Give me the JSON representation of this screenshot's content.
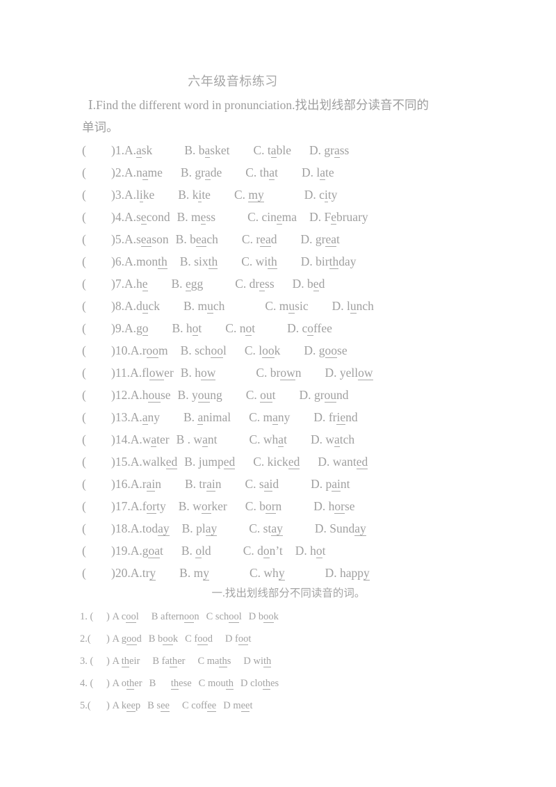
{
  "document": {
    "title": "六年级音标练习",
    "section1": {
      "instruction_prefix": "Ⅰ.Find the different word in pronunciation.",
      "instruction_cn": "找出划线部分读音不同的",
      "instruction_cn2": "单词。",
      "paren_open": "(",
      "paren_close": ")",
      "questions": [
        {
          "num": "1.",
          "a": "A.",
          "a_pre": "",
          "a_u": "a",
          "a_post": "sk",
          "b": "B.",
          "b_pre": "b",
          "b_u": "a",
          "b_post": "sket",
          "c": "C.",
          "c_pre": "t",
          "c_u": "a",
          "c_post": "ble",
          "d": "D.",
          "d_pre": "gr",
          "d_u": "a",
          "d_post": "ss",
          "gap1": "sp5",
          "gap2": "sp4",
          "gap3": "sp3"
        },
        {
          "num": "2.",
          "a": "A.",
          "a_pre": "n",
          "a_u": "a",
          "a_post": "me",
          "b": "B.",
          "b_pre": "gr",
          "b_u": "a",
          "b_post": "de",
          "c": "C.",
          "c_pre": "th",
          "c_u": "a",
          "c_post": "t",
          "d": "D.",
          "d_pre": "l",
          "d_u": "a",
          "d_post": "te",
          "gap1": "sp3",
          "gap2": "sp4",
          "gap3": "sp4"
        },
        {
          "num": "3.",
          "a": "A.",
          "a_pre": "l",
          "a_u": "i",
          "a_post": "ke",
          "b": "B.",
          "b_pre": "k",
          "b_u": "i",
          "b_post": "te",
          "c": "C.",
          "c_pre": "",
          "c_u": "my",
          "c_post": "",
          "d": "D.",
          "d_pre": "c",
          "d_u": "i",
          "d_post": "ty",
          "gap1": "sp4",
          "gap2": "sp4",
          "gap3": "sp6"
        },
        {
          "num": "4.",
          "a": "A.",
          "a_pre": "s",
          "a_u": "e",
          "a_post": "cond",
          "b": "B.",
          "b_pre": "m",
          "b_u": "e",
          "b_post": "ss",
          "c": "C.",
          "c_pre": "cin",
          "c_u": "e",
          "c_post": "ma",
          "d": "D.",
          "d_pre": "F",
          "d_u": "e",
          "d_post": "bruary",
          "gap1": "sp1",
          "gap2": "sp5",
          "gap3": "sp2"
        },
        {
          "num": "5.",
          "a": "A.",
          "a_pre": "s",
          "a_u": "ea",
          "a_post": "son",
          "b": "B.",
          "b_pre": "b",
          "b_u": "ea",
          "b_post": "ch",
          "c": "C.",
          "c_pre": "r",
          "c_u": "ea",
          "c_post": "d",
          "d": "D.",
          "d_pre": "gr",
          "d_u": "ea",
          "d_post": "t",
          "gap1": "sp1",
          "gap2": "sp4",
          "gap3": "sp4"
        },
        {
          "num": "6.",
          "a": "A.",
          "a_pre": "mon",
          "a_u": "th",
          "a_post": "",
          "b": "B.",
          "b_pre": "six",
          "b_u": "th",
          "b_post": "",
          "c": "C.",
          "c_pre": "wi",
          "c_u": "th",
          "c_post": "",
          "d": "D.",
          "d_pre": "bir",
          "d_u": "th",
          "d_post": "day",
          "gap1": "sp2",
          "gap2": "sp4",
          "gap3": "sp4"
        },
        {
          "num": "7.",
          "a": "A.",
          "a_pre": "h",
          "a_u": "e",
          "a_post": "",
          "b": "B.",
          "b_pre": "",
          "b_u": "e",
          "b_post": "gg",
          "c": "C.",
          "c_pre": "dr",
          "c_u": "e",
          "c_post": "ss",
          "d": "D.",
          "d_pre": "b",
          "d_u": "e",
          "d_post": "d",
          "gap1": "sp4",
          "gap2": "sp5",
          "gap3": "sp3"
        },
        {
          "num": "8.",
          "a": "A.",
          "a_pre": "d",
          "a_u": "u",
          "a_post": "ck",
          "b": "B.",
          "b_pre": "m",
          "b_u": "u",
          "b_post": "ch",
          "c": "C.",
          "c_pre": "m",
          "c_u": "u",
          "c_post": "sic",
          "d": "D.",
          "d_pre": "l",
          "d_u": "u",
          "d_post": "nch",
          "gap1": "sp4",
          "gap2": "sp6",
          "gap3": "sp4"
        },
        {
          "num": "9.",
          "a": "A.",
          "a_pre": "g",
          "a_u": "o",
          "a_post": "",
          "b": "B.",
          "b_pre": "h",
          "b_u": "o",
          "b_post": "t",
          "c": "C.",
          "c_pre": "n",
          "c_u": "o",
          "c_post": "t",
          "d": "D.",
          "d_pre": "c",
          "d_u": "o",
          "d_post": "ffee",
          "gap1": "sp4",
          "gap2": "sp4",
          "gap3": "sp5"
        },
        {
          "num": "10.",
          "a": "A.",
          "a_pre": "r",
          "a_u": "oo",
          "a_post": "m",
          "b": "B.",
          "b_pre": "sch",
          "b_u": "oo",
          "b_post": "l",
          "c": "C.",
          "c_pre": "l",
          "c_u": "oo",
          "c_post": "k",
          "d": "D.",
          "d_pre": "g",
          "d_u": "oo",
          "d_post": "se",
          "gap1": "sp2",
          "gap2": "sp3",
          "gap3": "sp4"
        },
        {
          "num": "11.",
          "a": "A.",
          "a_pre": "fl",
          "a_u": "ow",
          "a_post": "er",
          "b": "B.",
          "b_pre": "h",
          "b_u": "ow",
          "b_post": "",
          "c": "C.",
          "c_pre": "br",
          "c_u": "ow",
          "c_post": "n",
          "d": "D.",
          "d_pre": "yell",
          "d_u": "ow",
          "d_post": "",
          "gap1": "sp1",
          "gap2": "sp6",
          "gap3": "sp4"
        },
        {
          "num": "12.",
          "a": "A.",
          "a_pre": "h",
          "a_u": "ou",
          "a_post": "se",
          "b": "B.",
          "b_pre": "y",
          "b_u": "ou",
          "b_post": "ng",
          "c": "C.",
          "c_pre": "",
          "c_u": "ou",
          "c_post": "t",
          "d": "D.",
          "d_pre": "gr",
          "d_u": "ou",
          "d_post": "nd",
          "gap1": "sp1",
          "gap2": "sp4",
          "gap3": "sp4"
        },
        {
          "num": "13.",
          "a": "A.",
          "a_pre": "",
          "a_u": "a",
          "a_post": "ny",
          "b": "B.",
          "b_pre": "",
          "b_u": "a",
          "b_post": "nimal",
          "c": "C.",
          "c_pre": "m",
          "c_u": "a",
          "c_post": "ny",
          "d": "D.",
          "d_pre": "fr",
          "d_u": "ie",
          "d_post": "nd",
          "gap1": "sp4",
          "gap2": "sp3",
          "gap3": "sp4"
        },
        {
          "num": "14.",
          "a": "A.",
          "a_pre": "w",
          "a_u": "a",
          "a_post": "ter",
          "b": "B .",
          "b_pre": "w",
          "b_u": "a",
          "b_post": "nt",
          "c": "C.",
          "c_pre": "wh",
          "c_u": "a",
          "c_post": "t",
          "d": "D.",
          "d_pre": "w",
          "d_u": "a",
          "d_post": "tch",
          "gap1": "sp1",
          "gap2": "sp5",
          "gap3": "sp4"
        },
        {
          "num": "15.",
          "a": "A.",
          "a_pre": "walk",
          "a_u": "ed",
          "a_post": "",
          "b": "B.",
          "b_pre": "jump",
          "b_u": "ed",
          "b_post": "",
          "c": "C.",
          "c_pre": "kick",
          "c_u": "ed",
          "c_post": "",
          "d": "D.",
          "d_pre": "want",
          "d_u": "ed",
          "d_post": "",
          "gap1": "sp1",
          "gap2": "sp3",
          "gap3": "sp3"
        },
        {
          "num": "16.",
          "a": "A.",
          "a_pre": "r",
          "a_u": "ai",
          "a_post": "n",
          "b": "B.",
          "b_pre": "tr",
          "b_u": "ai",
          "b_post": "n",
          "c": "C.",
          "c_pre": "s",
          "c_u": "ai",
          "c_post": "d",
          "d": "D.",
          "d_pre": "p",
          "d_u": "ai",
          "d_post": "nt",
          "gap1": "sp4",
          "gap2": "sp4",
          "gap3": "sp5"
        },
        {
          "num": "17.",
          "a": "A.",
          "a_pre": "f",
          "a_u": "or",
          "a_post": "ty",
          "b": "B.",
          "b_pre": "w",
          "b_u": "or",
          "b_post": "ker",
          "c": "C.",
          "c_pre": "b",
          "c_u": "or",
          "c_post": "n",
          "d": "D.",
          "d_pre": "h",
          "d_u": "or",
          "d_post": "se",
          "gap1": "sp2",
          "gap2": "sp3",
          "gap3": "sp5"
        },
        {
          "num": "18.",
          "a": "A.",
          "a_pre": "tod",
          "a_u": "ay",
          "a_post": "",
          "b": "B.",
          "b_pre": "pl",
          "b_u": "ay",
          "b_post": "",
          "c": "C.",
          "c_pre": "st",
          "c_u": "ay",
          "c_post": "",
          "d": "D.",
          "d_pre": "Sund",
          "d_u": "ay",
          "d_post": "",
          "gap1": "sp2",
          "gap2": "sp5",
          "gap3": "sp5"
        },
        {
          "num": "19.",
          "a": "A.",
          "a_pre": "g",
          "a_u": "oa",
          "a_post": "t",
          "b": "B.",
          "b_pre": "",
          "b_u": "o",
          "b_post": "ld",
          "c": "C.",
          "c_pre": "d",
          "c_u": "o",
          "c_post": "n’t",
          "d": "D.",
          "d_pre": "h",
          "d_u": "o",
          "d_post": "t",
          "gap1": "sp3",
          "gap2": "sp5",
          "gap3": "sp2"
        },
        {
          "num": "20.",
          "a": "A.",
          "a_pre": "tr",
          "a_u": "y",
          "a_post": "",
          "b": "B.",
          "b_pre": "m",
          "b_u": "y",
          "b_post": "",
          "c": "C.",
          "c_pre": "wh",
          "c_u": "y",
          "c_post": "",
          "d": "D.",
          "d_pre": "happ",
          "d_u": "y",
          "d_post": "",
          "gap1": "sp4",
          "gap2": "sp6",
          "gap3": "sp6"
        }
      ]
    },
    "section2": {
      "title": "一.找出划线部分不同读音的词。",
      "questions": [
        {
          "label": "1. (",
          "close": ") ",
          "a": "A c",
          "a_u": "oo",
          "a_post": "l",
          "b": "B aftern",
          "b_u": "oo",
          "b_post": "n",
          "c": "C sch",
          "c_u": "oo",
          "c_post": "l",
          "d": "D b",
          "d_u": "oo",
          "d_post": "k",
          "gap1": "sp2",
          "gap2": "sp1",
          "gap3": "sp1"
        },
        {
          "label": "2.(",
          "close": ") ",
          "a": "A g",
          "a_u": "oo",
          "a_post": "d",
          "b": "B b",
          "b_u": "oo",
          "b_post": "k",
          "c": "C f",
          "c_u": "oo",
          "c_post": "d",
          "d": "D f",
          "d_u": "oo",
          "d_post": "t",
          "gap1": "sp1",
          "gap2": "sp1",
          "gap3": "sp2"
        },
        {
          "label": "3. (",
          "close": ") ",
          "a": "A ",
          "a_u": "th",
          "a_post": "eir",
          "b": "B fa",
          "b_u": "th",
          "b_post": "er",
          "c": "C ma",
          "c_u": "th",
          "c_post": "s",
          "d": "D wi",
          "d_u": "th",
          "d_post": "",
          "gap1": "sp2",
          "gap2": "sp2",
          "gap3": "sp2"
        },
        {
          "label": "4. (",
          "close": ") ",
          "a": "A o",
          "a_u": "th",
          "a_post": "er",
          "b": "B ",
          "b_pre_gap": "sp2",
          "b_u": "th",
          "b_post": "ese",
          "c": "C mou",
          "c_u": "th",
          "c_post": "",
          "d": "D clo",
          "d_u": "th",
          "d_post": "es",
          "gap1": "sp1",
          "gap2": "sp1",
          "gap3": "sp1"
        },
        {
          "label": "5.(",
          "close": ") ",
          "a": "A k",
          "a_u": "ee",
          "a_post": "p",
          "b": "B s",
          "b_u": "ee",
          "b_post": "",
          "c": "C coff",
          "c_u": "ee",
          "c_post": "",
          "d": "D m",
          "d_u": "ee",
          "d_post": "t",
          "gap1": "sp1",
          "gap2": "sp2",
          "gap3": "sp1"
        }
      ]
    }
  }
}
